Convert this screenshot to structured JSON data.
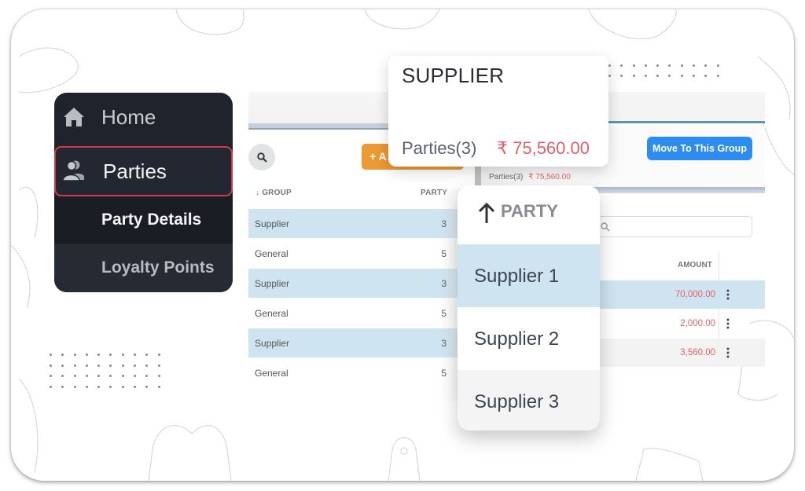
{
  "sidebar": {
    "items": [
      {
        "label": "Home",
        "icon": "home-icon"
      },
      {
        "label": "Parties",
        "icon": "users-icon",
        "selected": true
      },
      {
        "label": "Party Details"
      },
      {
        "label": "Loyalty Points"
      }
    ]
  },
  "group_panel": {
    "search_icon": "search-icon",
    "add_button_label": "+ A",
    "columns": {
      "group": "GROUP",
      "party": "PARTY"
    },
    "sort_icon": "arrow-down-icon",
    "rows": [
      {
        "group": "Supplier",
        "party": "3",
        "highlighted": true
      },
      {
        "group": "General",
        "party": "5",
        "highlighted": false
      },
      {
        "group": "Supplier",
        "party": "3",
        "highlighted": true
      },
      {
        "group": "General",
        "party": "5",
        "highlighted": false
      },
      {
        "group": "Supplier",
        "party": "3",
        "highlighted": true
      },
      {
        "group": "General",
        "party": "5",
        "highlighted": false
      }
    ]
  },
  "supplier_card": {
    "title": "SUPPLIER",
    "parties": "Parties(3)",
    "amount": "₹ 75,560.00"
  },
  "detail_panel": {
    "move_button_label": "Move To This Group",
    "parties_small": "Parties(3)",
    "amount_small": "₹ 75,560.00",
    "amount_header": "AMOUNT",
    "rows": [
      {
        "amount": "70,000.00",
        "highlighted": true
      },
      {
        "amount": "2,000.00",
        "highlighted": false
      },
      {
        "amount": "3,560.00",
        "highlighted": false
      }
    ]
  },
  "party_dropdown": {
    "header": "PARTY",
    "sort_icon": "arrow-up-icon",
    "items": [
      "Supplier 1",
      "Supplier 2",
      "Supplier 3"
    ],
    "selected": "Supplier 1"
  },
  "colors": {
    "sidebar_bg": "#1f232b",
    "selected_border": "#d13a45",
    "highlight_row": "#cfe4f1",
    "add_button": "#ec9a34",
    "move_button": "#2d8cf0",
    "amount_red": "#e0606a"
  }
}
